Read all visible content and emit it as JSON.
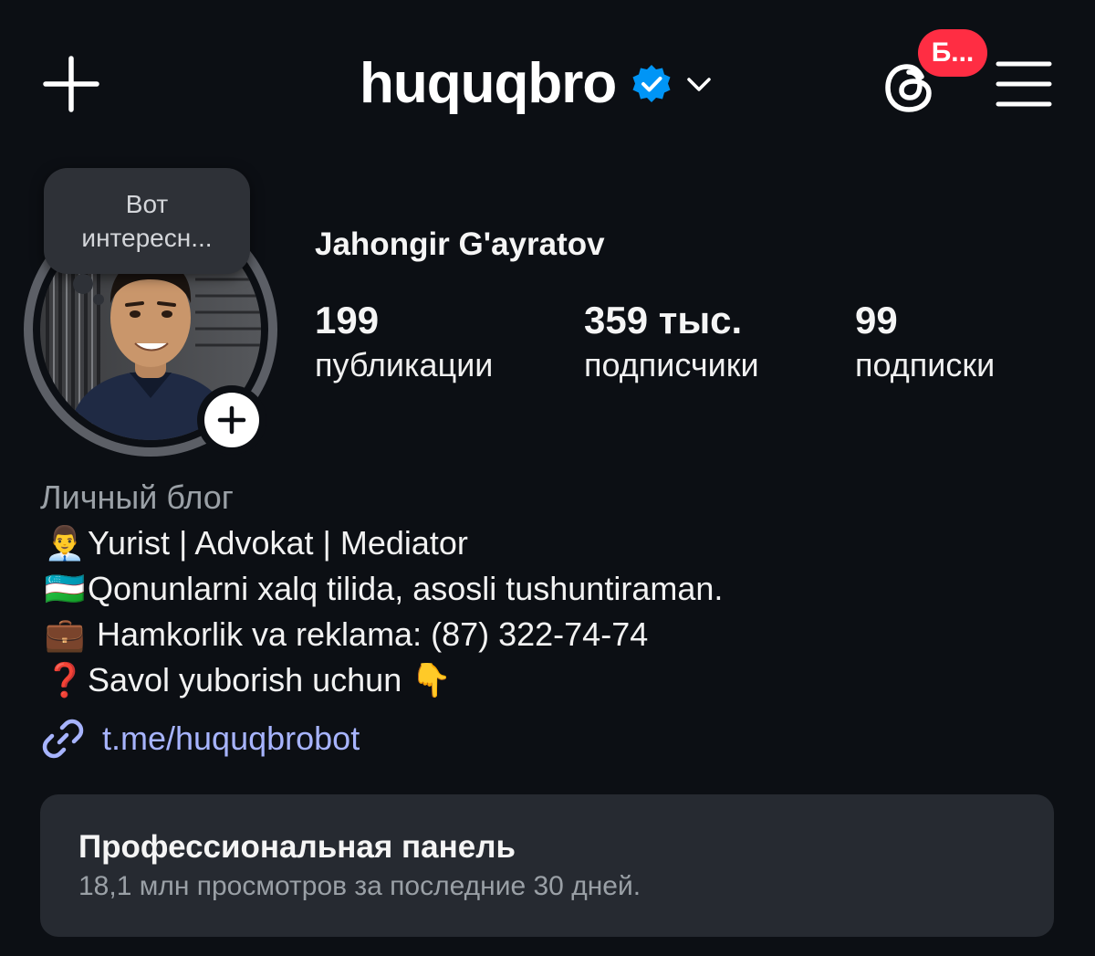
{
  "header": {
    "username": "huquqbro",
    "threads_badge": "Б..."
  },
  "note": {
    "line1": "Вот",
    "line2": "интересн..."
  },
  "profile": {
    "full_name": "Jahongir G'ayratov",
    "stats": [
      {
        "value": "199",
        "label": "публикации"
      },
      {
        "value": "359 тыс.",
        "label": "подписчики"
      },
      {
        "value": "99",
        "label": "подписки"
      }
    ]
  },
  "bio": {
    "category": "Личный блог",
    "lines": [
      {
        "emoji": "👨‍💼",
        "text": "Yurist | Advokat | Mediator"
      },
      {
        "emoji": "🇺🇿",
        "text": "Qonunlarni xalq tilida, asosli tushuntiraman."
      },
      {
        "emoji": "💼",
        "text": " Hamkorlik va reklama: (87) 322-74-74"
      },
      {
        "emoji": "❓",
        "text": "Savol yuborish uchun 👇"
      }
    ],
    "link": "t.me/huquqbrobot"
  },
  "pro_panel": {
    "title": "Профессиональная панель",
    "subtitle": "18,1 млн просмотров за последние 30 дней."
  },
  "colors": {
    "background": "#0c0f14",
    "verified_blue": "#0095f6",
    "badge_red": "#ff2d43",
    "link": "#a7b4ff",
    "panel": "#262a31"
  },
  "icons": [
    "plus-icon",
    "verified-icon",
    "chevron-down-icon",
    "threads-icon",
    "hamburger-menu-icon",
    "link-icon",
    "add-story-plus-icon"
  ]
}
